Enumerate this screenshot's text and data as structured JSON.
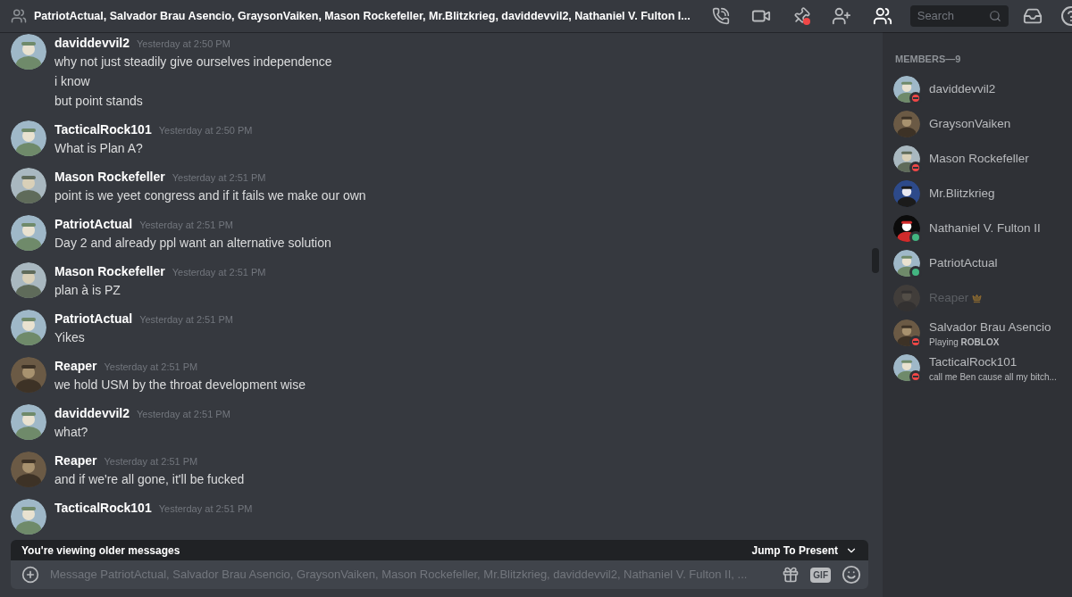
{
  "header": {
    "title": "PatriotActual, Salvador Brau Asencio, GraysonVaiken, Mason Rockefeller, Mr.Blitzkrieg, daviddevvil2, Nathaniel V. Fulton I...",
    "search_placeholder": "Search"
  },
  "messages": [
    {
      "author": "daviddevvil2",
      "time": "Yesterday at 2:50 PM",
      "lines": [
        "why not just steadily give ourselves independence",
        "i know",
        "but point stands"
      ]
    },
    {
      "author": "TacticalRock101",
      "time": "Yesterday at 2:50 PM",
      "lines": [
        "What is Plan A?"
      ]
    },
    {
      "author": "Mason Rockefeller",
      "time": "Yesterday at 2:51 PM",
      "lines": [
        "point is we yeet congress and if it fails we make our own"
      ]
    },
    {
      "author": "PatriotActual",
      "time": "Yesterday at 2:51 PM",
      "lines": [
        "Day 2 and already ppl want an alternative solution"
      ]
    },
    {
      "author": "Mason Rockefeller",
      "time": "Yesterday at 2:51 PM",
      "lines": [
        "plan à is PZ"
      ]
    },
    {
      "author": "PatriotActual",
      "time": "Yesterday at 2:51 PM",
      "lines": [
        "Yikes"
      ]
    },
    {
      "author": "Reaper",
      "time": "Yesterday at 2:51 PM",
      "lines": [
        "we hold USM by the throat development wise"
      ]
    },
    {
      "author": "daviddevvil2",
      "time": "Yesterday at 2:51 PM",
      "lines": [
        "what?"
      ]
    },
    {
      "author": "Reaper",
      "time": "Yesterday at 2:51 PM",
      "lines": [
        "and if we're all gone, it'll be fucked"
      ]
    },
    {
      "author": "TacticalRock101",
      "time": "Yesterday at 2:51 PM"
    }
  ],
  "older_bar": {
    "text": "You're viewing older messages",
    "jump": "Jump To Present"
  },
  "composer": {
    "gif_label": "GIF",
    "placeholder": "Message PatriotActual, Salvador Brau Asencio, GraysonVaiken, Mason Rockefeller, Mr.Blitzkrieg, daviddevvil2, Nathaniel V. Fulton II, ..."
  },
  "members": {
    "heading": "MEMBERS—9",
    "items": [
      {
        "name": "daviddevvil2",
        "do_not_disturb": true,
        "online": false,
        "offline": false,
        "owner": false
      },
      {
        "name": "GraysonVaiken",
        "do_not_disturb": false,
        "online": false,
        "offline": false,
        "owner": false
      },
      {
        "name": "Mason Rockefeller",
        "do_not_disturb": true,
        "online": false,
        "offline": false,
        "owner": false
      },
      {
        "name": "Mr.Blitzkrieg",
        "do_not_disturb": false,
        "online": false,
        "offline": false,
        "owner": false
      },
      {
        "name": "Nathaniel V. Fulton II",
        "do_not_disturb": false,
        "online": true,
        "offline": false,
        "owner": false
      },
      {
        "name": "PatriotActual",
        "do_not_disturb": false,
        "online": true,
        "offline": false,
        "owner": false
      },
      {
        "name": "Reaper",
        "do_not_disturb": false,
        "online": false,
        "offline": true,
        "owner": true
      },
      {
        "name": "Salvador Brau Asencio",
        "do_not_disturb": true,
        "online": false,
        "offline": false,
        "owner": false,
        "activity": "Playing **ROBLOX**"
      },
      {
        "name": "TacticalRock101",
        "do_not_disturb": true,
        "online": false,
        "offline": false,
        "owner": false,
        "activity": "call me Ben cause all my bitch..."
      }
    ]
  }
}
